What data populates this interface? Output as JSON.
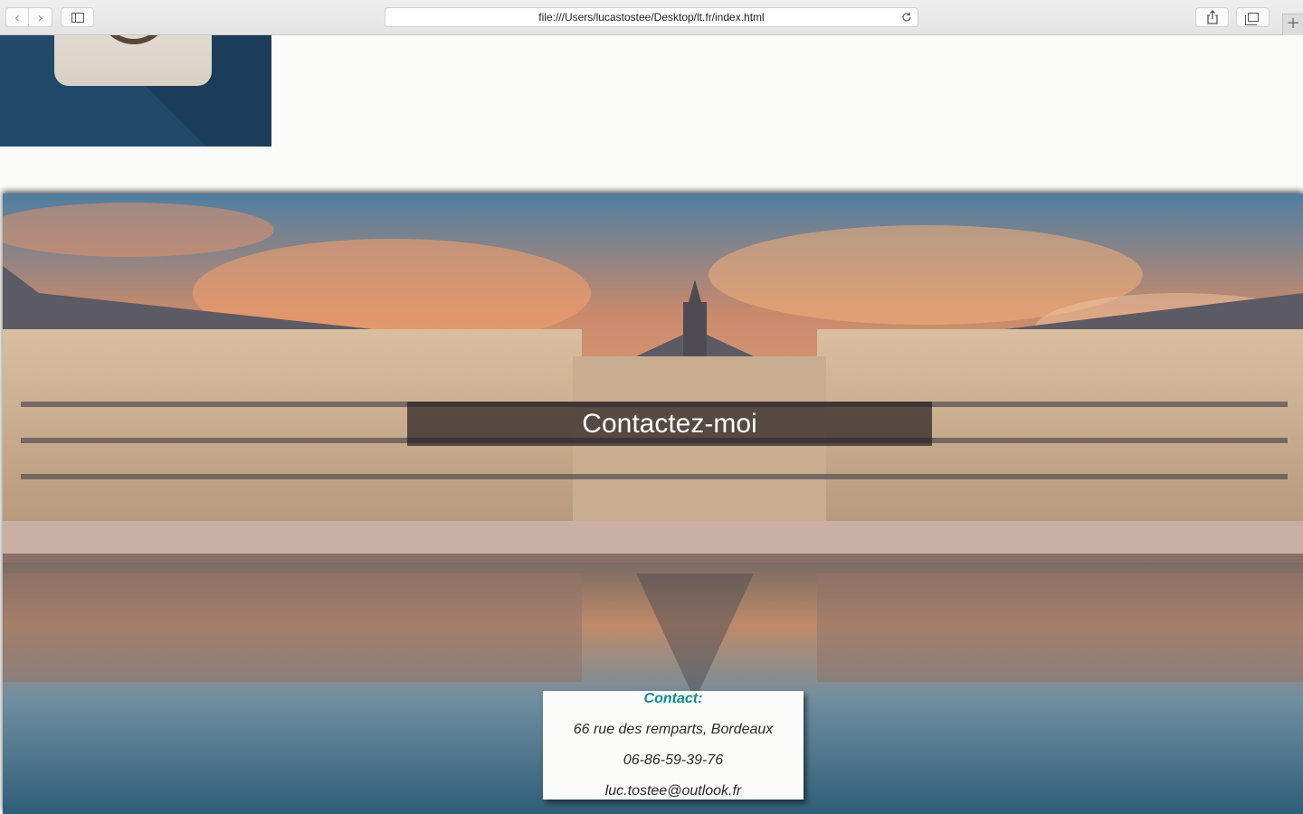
{
  "browser": {
    "url": "file:///Users/lucastostee/Desktop/lt.fr/index.html",
    "buttons": {
      "back": "back-icon",
      "forward": "forward-icon",
      "sidebar": "sidebar-icon",
      "share": "share-icon",
      "tabs": "tabs-icon",
      "new_tab": "+"
    }
  },
  "page": {
    "hero_title": "Contactez-moi",
    "contact": {
      "heading": "Contact:",
      "address": "66 rue des remparts, Bordeaux",
      "phone": "06-86-59-39-76",
      "email": "luc.tostee@outlook.fr"
    }
  },
  "colors": {
    "accent": "#0f8b8d",
    "logo_bg": "#21496a"
  }
}
